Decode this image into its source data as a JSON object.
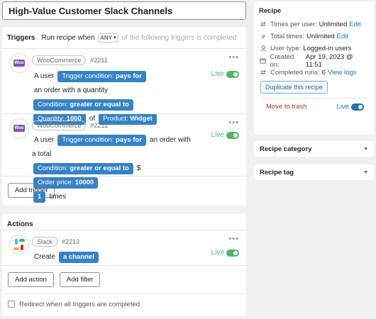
{
  "recipe_title": "High-Value Customer Slack Channels",
  "triggers": {
    "header_title": "Triggers",
    "run_label": "Run recipe when",
    "any_value": "ANY",
    "following_text": "of the following triggers is completed",
    "items": [
      {
        "integration": "WooCommerce",
        "logo_text": "Woo",
        "number": "#2211",
        "live_label": "Live",
        "text_a": "A user",
        "token_trigger_label": "Trigger condition:",
        "token_trigger_value": "pays for",
        "text_b": "an order with a quantity",
        "token_condition_label": "Condition:",
        "token_condition_value": "greater or equal to",
        "token_quantity_label": "Quantity:",
        "token_quantity_value": "1000",
        "text_c": "of",
        "token_product_label": "Product:",
        "token_product_value": "Widget"
      },
      {
        "integration": "WooCommerce",
        "logo_text": "Woo",
        "number": "#2212",
        "live_label": "Live",
        "text_a": "A user",
        "token_trigger_label": "Trigger condition:",
        "token_trigger_value": "pays for",
        "text_b": "an order with a total",
        "token_condition_label": "Condition:",
        "token_condition_value": "greater or equal to",
        "text_dollar": "$",
        "token_price_label": "Order price:",
        "token_price_value": "10000",
        "token_times_value": "1",
        "text_times": "times"
      }
    ],
    "add_trigger_label": "Add trigger"
  },
  "actions": {
    "header_title": "Actions",
    "items": [
      {
        "integration": "Slack",
        "number": "#2213",
        "live_label": "Live",
        "text_a": "Create",
        "token_value": "a channel"
      }
    ],
    "add_action_label": "Add action",
    "add_filter_label": "Add filter",
    "redirect_label": "Redirect when all triggers are completed"
  },
  "sidebar": {
    "recipe": {
      "title": "Recipe",
      "times_per_user_label": "Times per user:",
      "times_per_user_value": "Unlimited",
      "total_times_label": "Total times:",
      "total_times_value": "Unlimited",
      "edit_label": "Edit",
      "user_type_label": "User type:",
      "user_type_value": "Logged-in users",
      "created_label": "Created on:",
      "created_value": "Apr 19, 2023 @ 11:51",
      "completed_label": "Completed runs:",
      "completed_value": "6",
      "view_logs_label": "View logs",
      "duplicate_label": "Duplicate this recipe",
      "trash_label": "Move to trash",
      "live_label": "Live"
    },
    "category_title": "Recipe category",
    "tag_title": "Recipe tag"
  },
  "colors": {
    "token_blue": "#3582c4",
    "live_green": "#4ab866",
    "link_blue": "#2271b1",
    "trash_red": "#b32d2e",
    "woo_purple": "#7f54b3"
  }
}
